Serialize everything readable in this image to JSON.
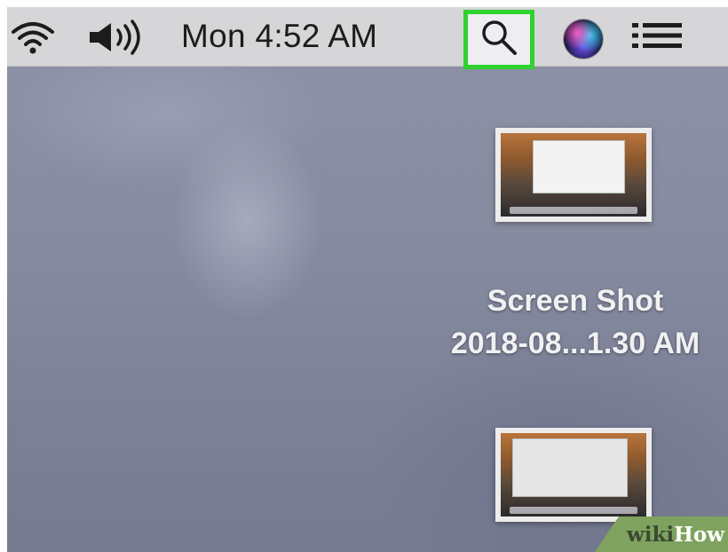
{
  "menubar": {
    "wifi_icon": "wifi-icon",
    "volume_icon": "volume-icon",
    "clock": "Mon 4:52 AM",
    "spotlight_icon": "search-icon",
    "spotlight_highlight_color": "#2fd12f",
    "siri_icon": "siri-icon",
    "notification_icon": "list-icon"
  },
  "desktop": {
    "files": [
      {
        "name_line1": "Screen Shot",
        "name_line2": "2018-08...1.30 AM",
        "icon": "screenshot-thumbnail"
      },
      {
        "name_line1": "",
        "name_line2": "",
        "icon": "screenshot-thumbnail"
      }
    ]
  },
  "watermark": {
    "part1": "wiki",
    "part2": "How"
  }
}
